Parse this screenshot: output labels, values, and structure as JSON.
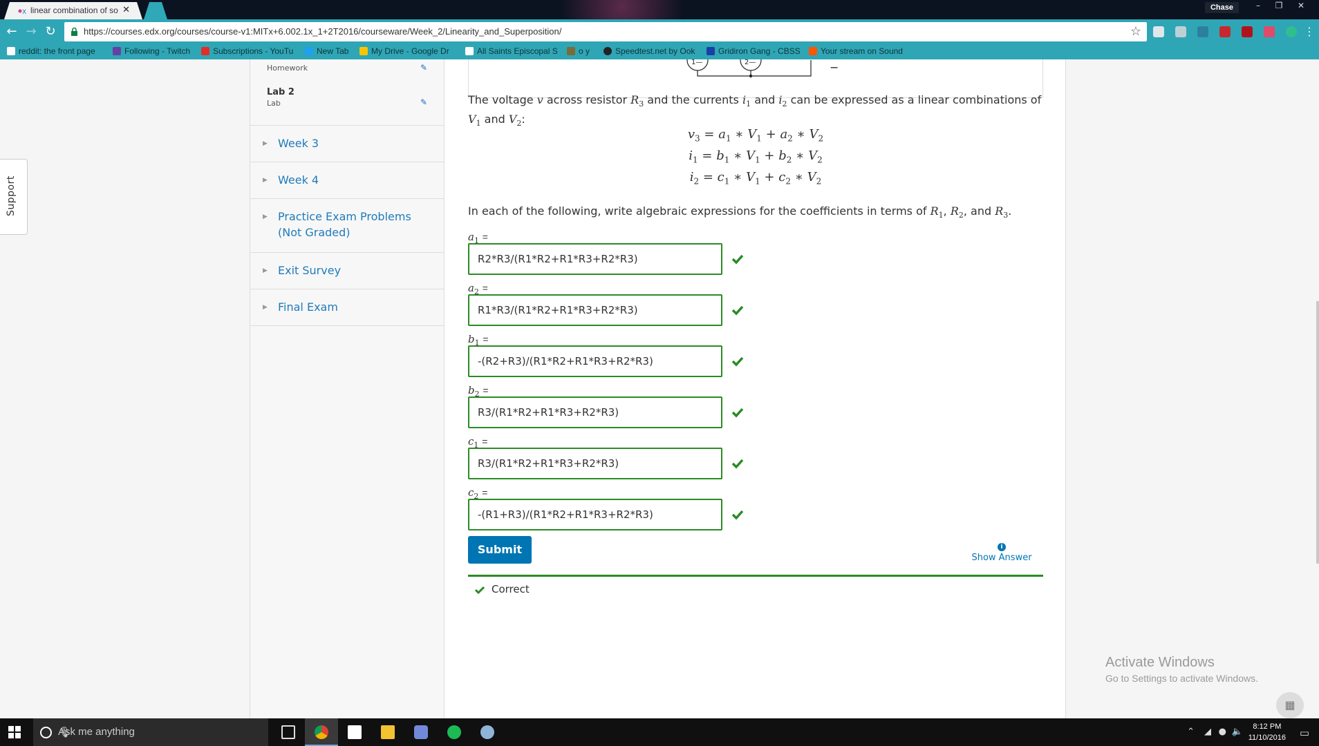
{
  "browser": {
    "tab_title": "linear combination of so",
    "url": "https://courses.edx.org/courses/course-v1:MITx+6.002.1x_1+2T2016/courseware/Week_2/Linearity_and_Superposition/",
    "profile_name": "Chase"
  },
  "bookmarks": [
    {
      "label": "reddit: the front page",
      "color": "#ff5700"
    },
    {
      "label": "Following - Twitch",
      "color": "#6441a5"
    },
    {
      "label": "Subscriptions - YouTu",
      "color": "#e52d27"
    },
    {
      "label": "New Tab",
      "color": "#1da1f2"
    },
    {
      "label": "My Drive - Google Dr",
      "color": "#f7c600"
    },
    {
      "label": "All Saints Episcopal S",
      "color": "#ffffff"
    },
    {
      "label": "o y",
      "color": "#7a6b3a"
    },
    {
      "label": "Speedtest.net by Ook",
      "color": "#222222"
    },
    {
      "label": "Gridiron Gang - CBSS",
      "color": "#1a3fa6"
    },
    {
      "label": "Your stream on Sound",
      "color": "#ff5500"
    }
  ],
  "support_tab": "Support",
  "sidebar": {
    "subsections": [
      {
        "title": "",
        "subtitle": "Homework"
      },
      {
        "title": "Lab 2",
        "subtitle": "Lab"
      }
    ],
    "chapters": [
      "Week 3",
      "Week 4",
      "Practice Exam Problems (Not Graded)",
      "Exit Survey",
      "Final Exam"
    ]
  },
  "problem": {
    "figure_minus": "−",
    "intro_1": "The voltage",
    "intro_2": "across resistor",
    "intro_3": "and the currents",
    "intro_4": "and",
    "intro_5": "can be expressed as a linear combinations of",
    "intro_6": "and",
    "intro_7": ":",
    "instr_1": "In each of the following, write algebraic expressions for the coefficients in terms of",
    "instr_2": ", and",
    "fields": [
      {
        "var": "a",
        "sub": "1",
        "value": "R2*R3/(R1*R2+R1*R3+R2*R3)"
      },
      {
        "var": "a",
        "sub": "2",
        "value": "R1*R3/(R1*R2+R1*R3+R2*R3)"
      },
      {
        "var": "b",
        "sub": "1",
        "value": "-(R2+R3)/(R1*R2+R1*R3+R2*R3)"
      },
      {
        "var": "b",
        "sub": "2",
        "value": "R3/(R1*R2+R1*R3+R2*R3)"
      },
      {
        "var": "c",
        "sub": "1",
        "value": "R3/(R1*R2+R1*R3+R2*R3)"
      },
      {
        "var": "c",
        "sub": "2",
        "value": "-(R1+R3)/(R1*R2+R1*R3+R2*R3)"
      }
    ],
    "submit_label": "Submit",
    "show_answer_label": "Show Answer",
    "status_label": "Correct",
    "correct_color": "#2b8b24"
  },
  "watermark": {
    "line1": "Activate Windows",
    "line2": "Go to Settings to activate Windows."
  },
  "taskbar": {
    "search_placeholder": "Ask me anything",
    "time": "8:12 PM",
    "date": "11/10/2016"
  }
}
